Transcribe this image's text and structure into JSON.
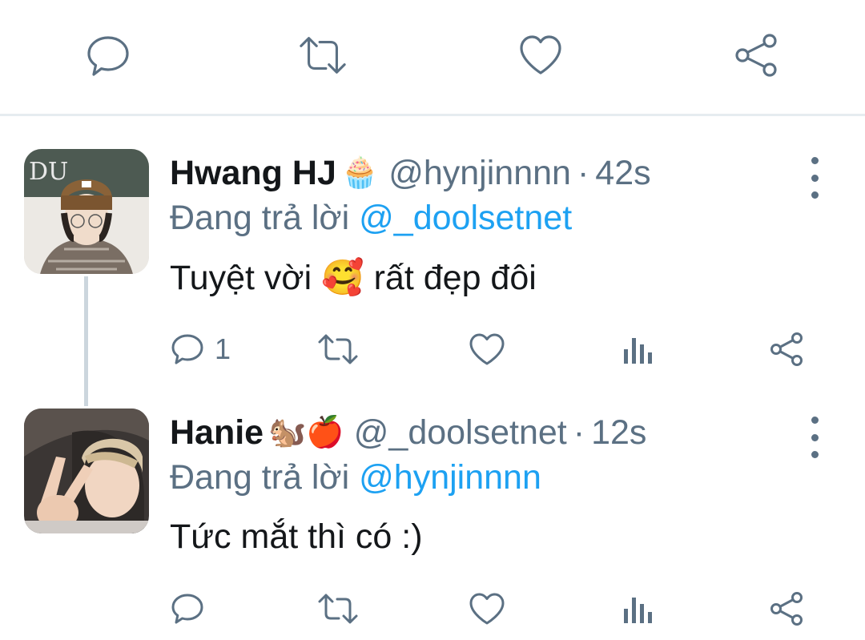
{
  "top_actions": {
    "icons": [
      "reply-icon",
      "retweet-icon",
      "like-icon",
      "share-icon"
    ]
  },
  "replies": [
    {
      "name": "Hwang HJ",
      "name_emoji": "🧁",
      "handle": "@hynjinnnn",
      "separator": "·",
      "time": "42s",
      "replying_prefix": "Đang trả lời",
      "replying_to": "@_doolsetnet",
      "text_before": "Tuyệt vời",
      "text_emoji": "🥰",
      "text_after": "rất đẹp đôi",
      "reply_count": "1"
    },
    {
      "name": "Hanie",
      "name_emoji": "🐿️🍎",
      "handle": "@_doolsetnet",
      "separator": "·",
      "time": "12s",
      "replying_prefix": "Đang trả lời",
      "replying_to": "@hynjinnnn",
      "text_before": "Tức mắt thì có :)",
      "text_emoji": "",
      "text_after": "",
      "reply_count": ""
    }
  ],
  "colors": {
    "text": "#14171a",
    "secondary": "#5b7083",
    "link": "#1da1f2",
    "divider": "#e6ecf0",
    "thread_line": "#ccd6dd"
  }
}
